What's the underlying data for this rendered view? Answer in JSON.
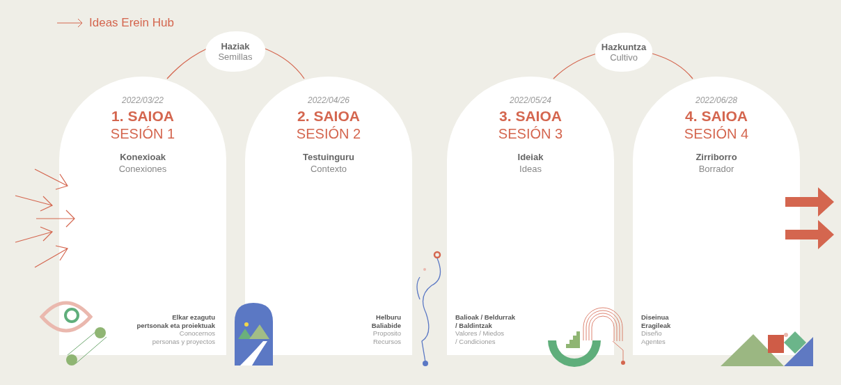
{
  "header": {
    "title": "Ideas Erein Hub"
  },
  "phases": [
    {
      "title": "Haziak",
      "subtitle": "Semillas"
    },
    {
      "title": "Hazkuntza",
      "subtitle": "Cultivo"
    }
  ],
  "sessions": [
    {
      "date": "2022/03/22",
      "number": "1. SAIOA",
      "session": "SESIÓN 1",
      "theme": "Konexioak",
      "theme_es": "Conexiones",
      "kind": "notes-right",
      "notes": [
        {
          "text": "Elkar ezagutu",
          "bold": true
        },
        {
          "text": "pertsonak eta proiektuak",
          "bold": true
        },
        {
          "text": "Conocernos",
          "bold": false
        },
        {
          "text": "personas y proyectos",
          "bold": false
        }
      ]
    },
    {
      "date": "2022/04/26",
      "number": "2. SAIOA",
      "session": "SESIÓN 2",
      "theme": "Testuinguru",
      "theme_es": "Contexto",
      "kind": "notes-right",
      "notes": [
        {
          "text": "Helburu",
          "bold": true
        },
        {
          "text": "Baliabide",
          "bold": true
        },
        {
          "text": "Proposito",
          "bold": false
        },
        {
          "text": "Recursos",
          "bold": false
        }
      ]
    },
    {
      "date": "2022/05/24",
      "number": "3. SAIOA",
      "session": "SESIÓN 3",
      "theme": "Ideiak",
      "theme_es": "Ideas",
      "kind": "notes-left",
      "notes": [
        {
          "text": "Balioak / Beldurrak",
          "bold": true
        },
        {
          "text": "/ Baldintzak",
          "bold": true
        },
        {
          "text": "Valores / Miedos",
          "bold": false
        },
        {
          "text": "/ Condiciones",
          "bold": false
        }
      ]
    },
    {
      "date": "2022/06/28",
      "number": "4. SAIOA",
      "session": "SESIÓN 4",
      "theme": "Zirriborro",
      "theme_es": "Borrador",
      "kind": "notes-left",
      "notes": [
        {
          "text": "Diseinua",
          "bold": true
        },
        {
          "text": "Eragileak",
          "bold": true
        },
        {
          "text": "Diseño",
          "bold": false
        },
        {
          "text": "Agentes",
          "bold": false
        }
      ]
    }
  ]
}
